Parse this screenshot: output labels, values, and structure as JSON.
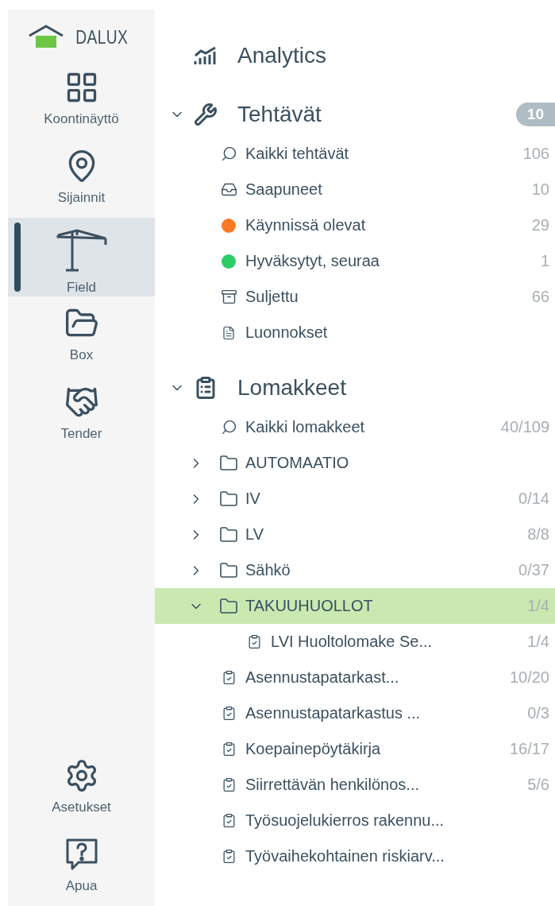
{
  "logo": {
    "text": "DALUX"
  },
  "nav": [
    {
      "label": "Koontinäyttö",
      "kind": "dashboard",
      "selected": false
    },
    {
      "label": "Sijainnit",
      "kind": "location",
      "selected": false
    },
    {
      "label": "Field",
      "kind": "crane",
      "selected": true
    },
    {
      "label": "Box",
      "kind": "folder",
      "selected": false
    },
    {
      "label": "Tender",
      "kind": "handshake",
      "selected": false
    }
  ],
  "nav_bottom": [
    {
      "label": "Asetukset",
      "kind": "settings",
      "selected": false
    },
    {
      "label": "Apua",
      "kind": "help",
      "selected": false
    }
  ],
  "sections": [
    {
      "title": "Analytics",
      "kind": "analytics"
    },
    {
      "title": "Tehtävät",
      "kind": "tasks",
      "expanded": true,
      "badge": "10",
      "items": [
        {
          "label": "Kaikki tehtävät",
          "kind": "search",
          "count": "106",
          "selected": false
        },
        {
          "label": "Saapuneet",
          "kind": "inbox",
          "count": "10",
          "selected": false
        },
        {
          "label": "Käynnissä olevat",
          "kind": "dot",
          "color": "#fa7a26",
          "count": "29",
          "selected": false
        },
        {
          "label": "Hyväksytyt, seuraa",
          "kind": "dot",
          "color": "#2ecc67",
          "count": "1",
          "selected": false
        },
        {
          "label": "Suljettu",
          "kind": "archive",
          "count": "66",
          "selected": false
        },
        {
          "label": "Luonnokset",
          "kind": "draft",
          "selected": false
        }
      ]
    },
    {
      "title": "Lomakkeet",
      "kind": "forms",
      "expanded": true,
      "items": [
        {
          "label": "Kaikki lomakkeet",
          "kind": "search",
          "count": "40/109",
          "selected": false
        },
        {
          "label": "AUTOMAATIO",
          "kind": "folder",
          "expanded": false,
          "selected": false
        },
        {
          "label": "IV",
          "kind": "folder",
          "expanded": false,
          "count": "0/14",
          "selected": false
        },
        {
          "label": "LV",
          "kind": "folder",
          "expanded": false,
          "count": "8/8",
          "selected": false
        },
        {
          "label": "Sähkö",
          "kind": "folder",
          "expanded": false,
          "count": "0/37",
          "selected": false
        },
        {
          "label": "TAKUUHUOLLOT",
          "kind": "folder",
          "expanded": true,
          "count": "1/4",
          "selected": true,
          "children": [
            {
              "label": "LVI Huoltolomake Se...",
              "kind": "form",
              "count": "1/4",
              "selected": false
            }
          ]
        },
        {
          "label": "Asennustapatarkast...",
          "kind": "form",
          "count": "10/20",
          "selected": false
        },
        {
          "label": "Asennustapatarkastus ...",
          "kind": "form",
          "count": "0/3",
          "selected": false
        },
        {
          "label": "Koepainepöytäkirja",
          "kind": "form",
          "count": "16/17",
          "selected": false
        },
        {
          "label": "Siirrettävän henkilönos...",
          "kind": "form",
          "count": "5/6",
          "selected": false
        },
        {
          "label": "Työsuojelukierros rakennu...",
          "kind": "form",
          "selected": false
        },
        {
          "label": "Työvaihekohtainen riskiarv...",
          "kind": "form",
          "selected": false
        }
      ]
    }
  ]
}
